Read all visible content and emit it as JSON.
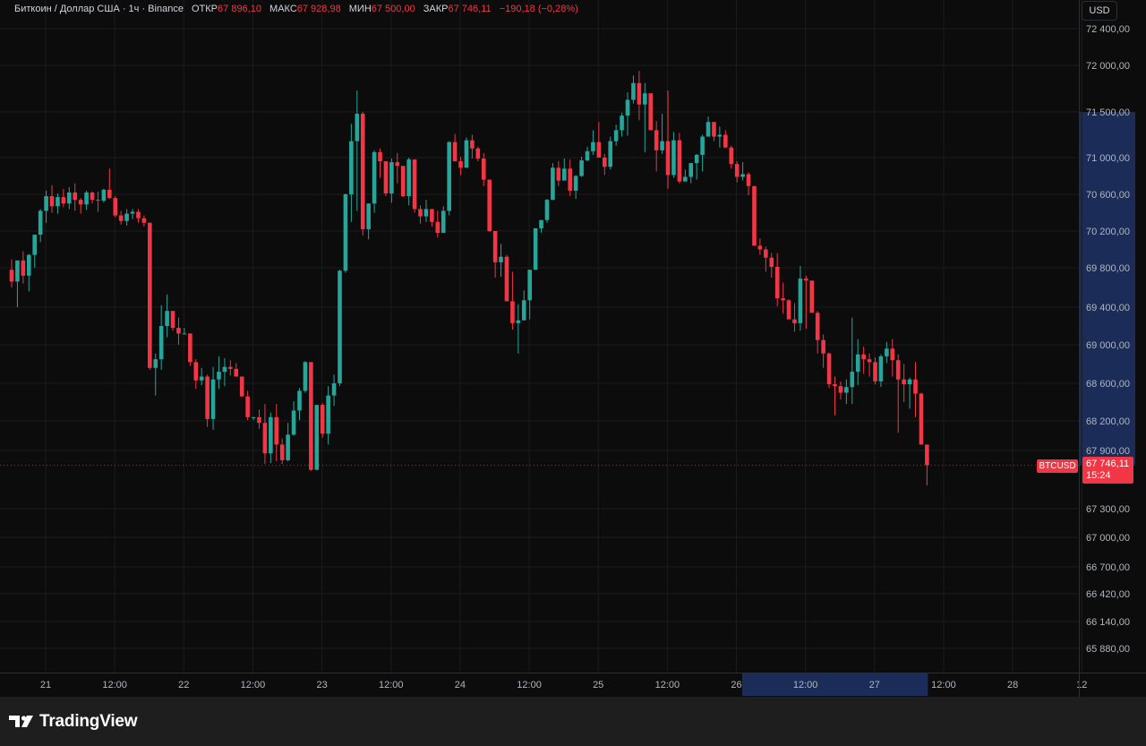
{
  "header": {
    "symbol": "Биткоин / Доллар США · 1ч · Binance",
    "open_label": "ОТКР",
    "open_value": "67 896,10",
    "high_label": "МАКС",
    "high_value": "67 928,98",
    "low_label": "МИН",
    "low_value": "67 500,00",
    "close_label": "ЗАКР",
    "close_value": "67 746,11",
    "change_value": "−190,18 (−0,28%)"
  },
  "currency": "USD",
  "price_scale": {
    "labels": [
      "72 400,00",
      "72 000,00",
      "71 500,00",
      "71 000,00",
      "70 600,00",
      "70 200,00",
      "69 800,00",
      "69 400,00",
      "69 000,00",
      "68 600,00",
      "68 200,00",
      "67 900,00",
      "67 300,00",
      "67 000,00",
      "66 700,00",
      "66 420,00",
      "66 140,00",
      "65 880,00"
    ]
  },
  "time_scale": {
    "labels": [
      "21",
      "12:00",
      "22",
      "12:00",
      "23",
      "12:00",
      "24",
      "12:00",
      "25",
      "12:00",
      "26",
      "12:00",
      "27",
      "12:00",
      "28",
      "12"
    ]
  },
  "last_price": {
    "symbol": "BTCUSD",
    "price": "67 746,11",
    "countdown": "15:24"
  },
  "brand": {
    "name": "TradingView"
  },
  "colors": {
    "up": "#26a69a",
    "down": "#f23645",
    "background": "#0c0c0c",
    "grid": "#1c1c1c",
    "highlight": "#1a2c57"
  },
  "chart_data": {
    "type": "candlestick",
    "interval": "1h",
    "x_start": "21 00:00",
    "y_unit": "USD",
    "ylim": [
      65880,
      72400
    ],
    "candles": [
      [
        69780,
        69890,
        69600,
        69660
      ],
      [
        69660,
        69880,
        69400,
        69880
      ],
      [
        69880,
        69980,
        69640,
        69720
      ],
      [
        69720,
        69950,
        69560,
        69940
      ],
      [
        69940,
        70160,
        69800,
        70160
      ],
      [
        70160,
        70440,
        70080,
        70420
      ],
      [
        70420,
        70640,
        70290,
        70580
      ],
      [
        70580,
        70700,
        70400,
        70470
      ],
      [
        70470,
        70610,
        70390,
        70570
      ],
      [
        70570,
        70660,
        70460,
        70500
      ],
      [
        70500,
        70680,
        70440,
        70620
      ],
      [
        70620,
        70720,
        70420,
        70540
      ],
      [
        70540,
        70560,
        70390,
        70490
      ],
      [
        70490,
        70640,
        70430,
        70620
      ],
      [
        70620,
        70630,
        70500,
        70540
      ],
      [
        70540,
        70630,
        70410,
        70530
      ],
      [
        70530,
        70660,
        70510,
        70650
      ],
      [
        70650,
        70880,
        70550,
        70560
      ],
      [
        70560,
        70580,
        70350,
        70370
      ],
      [
        70370,
        70420,
        70270,
        70310
      ],
      [
        70310,
        70440,
        70260,
        70390
      ],
      [
        70390,
        70440,
        70330,
        70410
      ],
      [
        70410,
        70440,
        70290,
        70340
      ],
      [
        70340,
        70370,
        70250,
        70290
      ],
      [
        70290,
        70290,
        68740,
        68760
      ],
      [
        68760,
        68910,
        68470,
        68850
      ],
      [
        68850,
        69420,
        68740,
        69200
      ],
      [
        69200,
        69530,
        69080,
        69360
      ],
      [
        69360,
        69340,
        69150,
        69180
      ],
      [
        69180,
        69290,
        69000,
        69120
      ],
      [
        69120,
        69180,
        69120,
        69120
      ],
      [
        69120,
        69120,
        68780,
        68820
      ],
      [
        68820,
        68850,
        68540,
        68630
      ],
      [
        68630,
        68760,
        68580,
        68670
      ],
      [
        68670,
        68690,
        68140,
        68220
      ],
      [
        68220,
        68770,
        68110,
        68640
      ],
      [
        68640,
        68880,
        68540,
        68720
      ],
      [
        68720,
        68860,
        68570,
        68770
      ],
      [
        68770,
        68840,
        68680,
        68750
      ],
      [
        68750,
        68810,
        68670,
        68670
      ],
      [
        68670,
        68620,
        68460,
        68460
      ],
      [
        68460,
        68520,
        68210,
        68240
      ],
      [
        68240,
        68240,
        68210,
        68240
      ],
      [
        68240,
        68320,
        68120,
        68180
      ],
      [
        68180,
        68380,
        67760,
        67870
      ],
      [
        67870,
        68290,
        67770,
        68240
      ],
      [
        68240,
        68380,
        67790,
        67960
      ],
      [
        67960,
        68020,
        67760,
        67800
      ],
      [
        67800,
        68180,
        67790,
        68060
      ],
      [
        68060,
        68410,
        68050,
        68310
      ],
      [
        68310,
        68550,
        68210,
        68520
      ],
      [
        68520,
        68830,
        68500,
        68820
      ],
      [
        68820,
        68820,
        67690,
        67700
      ],
      [
        67700,
        68290,
        67700,
        68370
      ],
      [
        68370,
        68390,
        68030,
        68070
      ],
      [
        68070,
        68570,
        67960,
        68470
      ],
      [
        68470,
        68690,
        68360,
        68600
      ],
      [
        68600,
        69780,
        68570,
        69770
      ],
      [
        69770,
        70610,
        69750,
        70600
      ],
      [
        70600,
        71370,
        70300,
        71180
      ],
      [
        71180,
        71730,
        70420,
        71480
      ],
      [
        71480,
        71500,
        70150,
        70220
      ],
      [
        70220,
        70500,
        70110,
        70500
      ],
      [
        70500,
        71080,
        70400,
        71060
      ],
      [
        71060,
        71100,
        70780,
        70960
      ],
      [
        70960,
        70870,
        70580,
        70610
      ],
      [
        70610,
        70990,
        70510,
        70950
      ],
      [
        70950,
        71050,
        70720,
        70910
      ],
      [
        70910,
        70890,
        70570,
        70580
      ],
      [
        70580,
        71000,
        70480,
        70980
      ],
      [
        70980,
        70980,
        70400,
        70440
      ],
      [
        70440,
        70480,
        70280,
        70360
      ],
      [
        70360,
        70540,
        70300,
        70440
      ],
      [
        70440,
        70440,
        70250,
        70300
      ],
      [
        70300,
        70420,
        70130,
        70180
      ],
      [
        70180,
        70470,
        70200,
        70420
      ],
      [
        70420,
        71180,
        70370,
        71170
      ],
      [
        71170,
        71260,
        70960,
        70960
      ],
      [
        70960,
        71010,
        70810,
        70890
      ],
      [
        70890,
        71220,
        70890,
        71190
      ],
      [
        71190,
        71250,
        70990,
        71100
      ],
      [
        71100,
        71120,
        70960,
        70990
      ],
      [
        70990,
        71050,
        70690,
        70760
      ],
      [
        70760,
        70760,
        70190,
        70200
      ],
      [
        70200,
        70160,
        69700,
        69860
      ],
      [
        69860,
        70060,
        69710,
        69920
      ],
      [
        69920,
        69940,
        69530,
        69460
      ],
      [
        69460,
        69760,
        69160,
        69230
      ],
      [
        69230,
        69430,
        68910,
        69260
      ],
      [
        69260,
        69570,
        69270,
        69470
      ],
      [
        69470,
        69770,
        69270,
        69780
      ],
      [
        69780,
        70230,
        69780,
        70230
      ],
      [
        70230,
        70320,
        70180,
        70320
      ],
      [
        70320,
        70550,
        70290,
        70540
      ],
      [
        70540,
        70940,
        70540,
        70890
      ],
      [
        70890,
        70960,
        70690,
        70750
      ],
      [
        70750,
        70990,
        70770,
        70880
      ],
      [
        70880,
        70980,
        70580,
        70640
      ],
      [
        70640,
        70810,
        70550,
        70800
      ],
      [
        70800,
        71010,
        70790,
        70970
      ],
      [
        70970,
        71120,
        70960,
        71070
      ],
      [
        71070,
        71300,
        71030,
        71170
      ],
      [
        71170,
        71390,
        71020,
        71000
      ],
      [
        71000,
        71040,
        70810,
        70900
      ],
      [
        70900,
        71230,
        70870,
        71180
      ],
      [
        71180,
        71360,
        71130,
        71300
      ],
      [
        71300,
        71490,
        71230,
        71460
      ],
      [
        71460,
        71710,
        71240,
        71630
      ],
      [
        71630,
        71890,
        71590,
        71810
      ],
      [
        71810,
        71940,
        71410,
        71580
      ],
      [
        71580,
        71810,
        71060,
        71700
      ],
      [
        71700,
        71700,
        71310,
        71300
      ],
      [
        71300,
        71400,
        70850,
        71080
      ],
      [
        71080,
        71480,
        71040,
        71180
      ],
      [
        71180,
        71730,
        70660,
        70810
      ],
      [
        70810,
        71280,
        70780,
        71190
      ],
      [
        71190,
        71270,
        70720,
        70740
      ],
      [
        70740,
        70870,
        70750,
        70790
      ],
      [
        70790,
        70940,
        70720,
        70940
      ],
      [
        70940,
        71040,
        70760,
        71030
      ],
      [
        71030,
        71250,
        70850,
        71230
      ],
      [
        71230,
        71450,
        71280,
        71390
      ],
      [
        71390,
        71360,
        71180,
        71230
      ],
      [
        71230,
        71340,
        71110,
        71250
      ],
      [
        71250,
        71300,
        71120,
        71110
      ],
      [
        71110,
        71130,
        70880,
        70930
      ],
      [
        70930,
        70960,
        70730,
        70790
      ],
      [
        70790,
        70950,
        70750,
        70820
      ],
      [
        70820,
        70840,
        70590,
        70690
      ],
      [
        70690,
        70690,
        70040,
        70040
      ],
      [
        70040,
        70120,
        69940,
        70000
      ],
      [
        70000,
        70030,
        69760,
        69910
      ],
      [
        69910,
        69960,
        69700,
        69810
      ],
      [
        69810,
        69960,
        69410,
        69490
      ],
      [
        69490,
        69650,
        69330,
        69470
      ],
      [
        69470,
        69480,
        69290,
        69270
      ],
      [
        69270,
        69440,
        69140,
        69230
      ],
      [
        69230,
        69820,
        69150,
        69690
      ],
      [
        69690,
        69720,
        69170,
        69670
      ],
      [
        69670,
        69580,
        69360,
        69340
      ],
      [
        69340,
        69360,
        68910,
        69050
      ],
      [
        69050,
        69110,
        68760,
        68910
      ],
      [
        68910,
        68920,
        68550,
        68590
      ],
      [
        68590,
        68670,
        68260,
        68570
      ],
      [
        68570,
        68620,
        68430,
        68500
      ],
      [
        68500,
        68640,
        68380,
        68560
      ],
      [
        68560,
        69290,
        68380,
        68720
      ],
      [
        68720,
        69060,
        68580,
        68900
      ],
      [
        68900,
        68980,
        68700,
        68850
      ],
      [
        68850,
        68910,
        68670,
        68820
      ],
      [
        68820,
        68870,
        68590,
        68620
      ],
      [
        68620,
        68900,
        68560,
        68880
      ],
      [
        68880,
        69030,
        68810,
        68960
      ],
      [
        68960,
        69060,
        68670,
        68840
      ],
      [
        68840,
        68900,
        68080,
        68640
      ],
      [
        68640,
        68800,
        68400,
        68590
      ],
      [
        68590,
        68660,
        68330,
        68640
      ],
      [
        68640,
        68820,
        68240,
        68490
      ],
      [
        68490,
        68500,
        67960,
        67960
      ],
      [
        67960,
        67840,
        67540,
        67750
      ]
    ]
  }
}
